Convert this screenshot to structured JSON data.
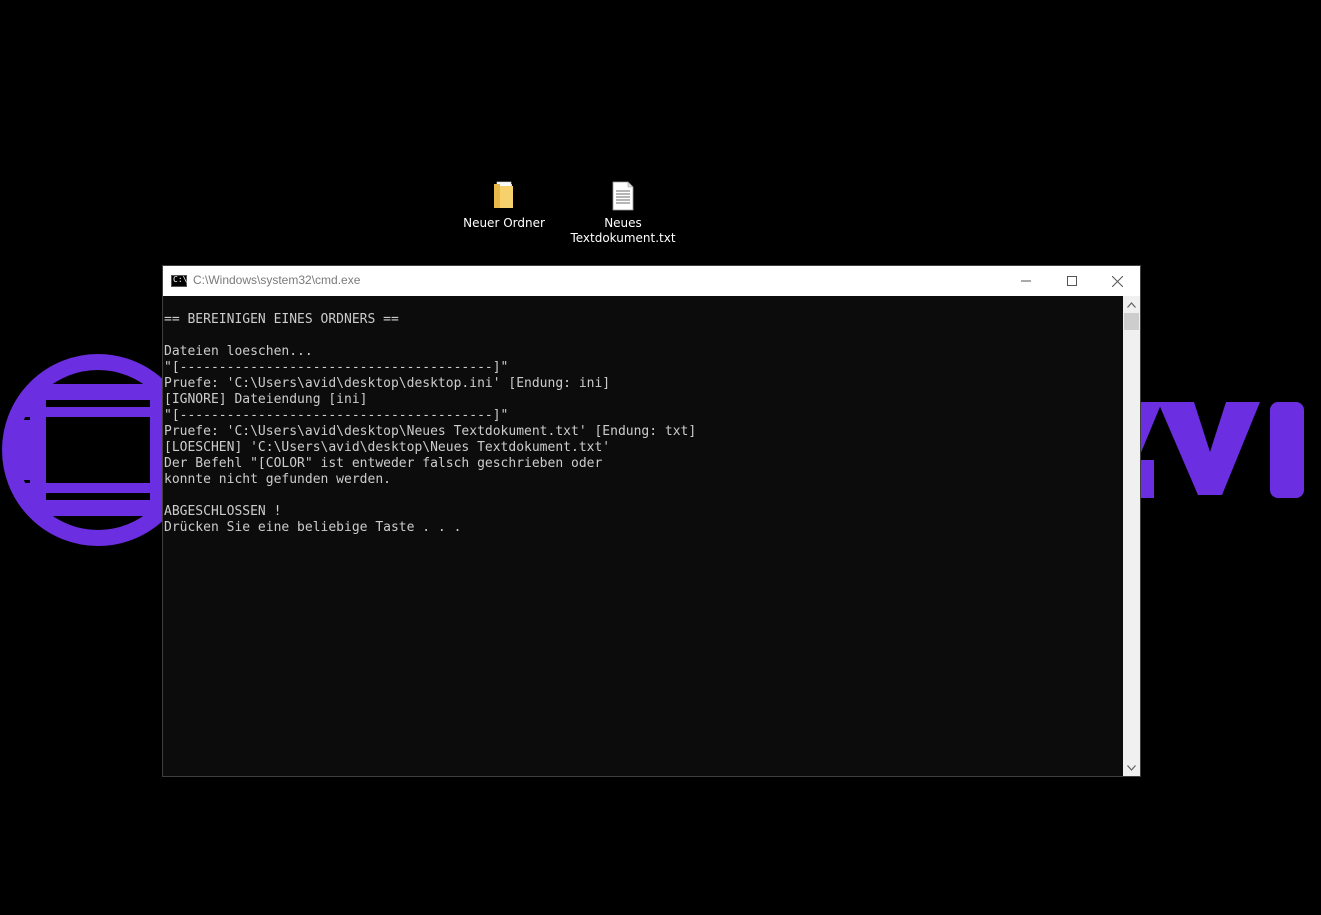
{
  "desktop": {
    "background_color": "#000000",
    "wallpaper": {
      "logo_text": "AVI",
      "accent_color": "#6b2ee0"
    },
    "icons": [
      {
        "label": "Neuer Ordner",
        "icon": "folder-icon"
      },
      {
        "label": "Neues\nTextdokument.txt",
        "icon": "text-file-icon"
      }
    ]
  },
  "window": {
    "title": "C:\\Windows\\system32\\cmd.exe",
    "app_icon": "cmd-icon",
    "controls": {
      "minimize": "minimize-icon",
      "maximize": "maximize-icon",
      "close": "close-icon"
    },
    "console_text_color": "#cccccc",
    "console_background": "#0c0c0c"
  },
  "console": {
    "lines": [
      "== BEREINIGEN EINES ORDNERS ==",
      "",
      "Dateien loeschen...",
      "\"[----------------------------------------]\"",
      "Pruefe: 'C:\\Users\\avid\\desktop\\desktop.ini' [Endung: ini]",
      "[IGNORE] Dateiendung [ini]",
      "\"[----------------------------------------]\"",
      "Pruefe: 'C:\\Users\\avid\\desktop\\Neues Textdokument.txt' [Endung: txt]",
      "[LOESCHEN] 'C:\\Users\\avid\\desktop\\Neues Textdokument.txt'",
      "Der Befehl \"[COLOR\" ist entweder falsch geschrieben oder",
      "konnte nicht gefunden werden.",
      "",
      "ABGESCHLOSSEN !",
      "Drücken Sie eine beliebige Taste . . ."
    ]
  }
}
